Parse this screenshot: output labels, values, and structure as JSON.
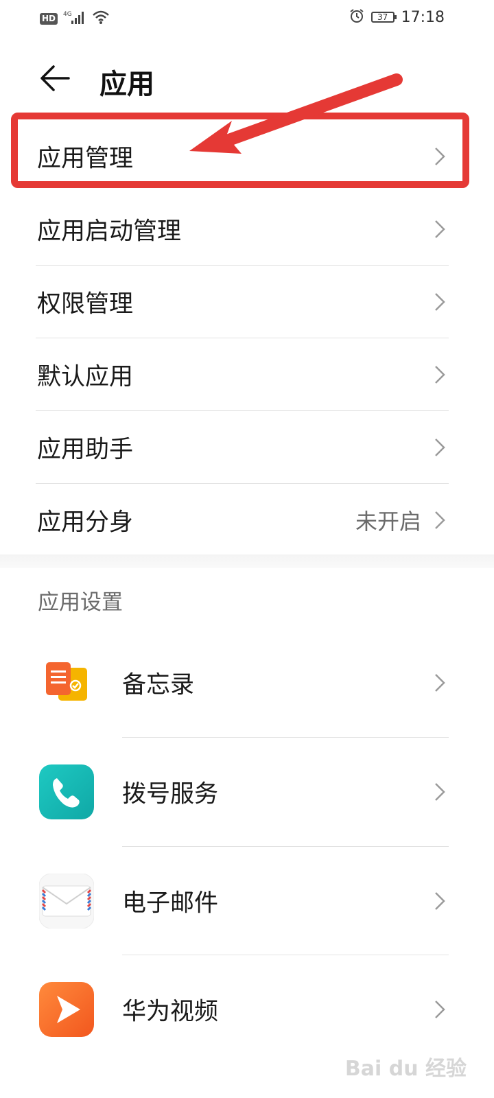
{
  "status_bar": {
    "hd": "HD",
    "network": "4G",
    "battery": "37",
    "time": "17:18"
  },
  "header": {
    "title": "应用"
  },
  "menu": [
    {
      "label": "应用管理"
    },
    {
      "label": "应用启动管理"
    },
    {
      "label": "权限管理"
    },
    {
      "label": "默认应用"
    },
    {
      "label": "应用助手"
    },
    {
      "label": "应用分身",
      "value": "未开启"
    }
  ],
  "section": {
    "title": "应用设置"
  },
  "apps": [
    {
      "label": "备忘录",
      "icon": "notes-app-icon"
    },
    {
      "label": "拨号服务",
      "icon": "dialer-app-icon"
    },
    {
      "label": "电子邮件",
      "icon": "email-app-icon"
    },
    {
      "label": "华为视频",
      "icon": "video-app-icon"
    }
  ],
  "colors": {
    "highlight": "#e53935"
  }
}
